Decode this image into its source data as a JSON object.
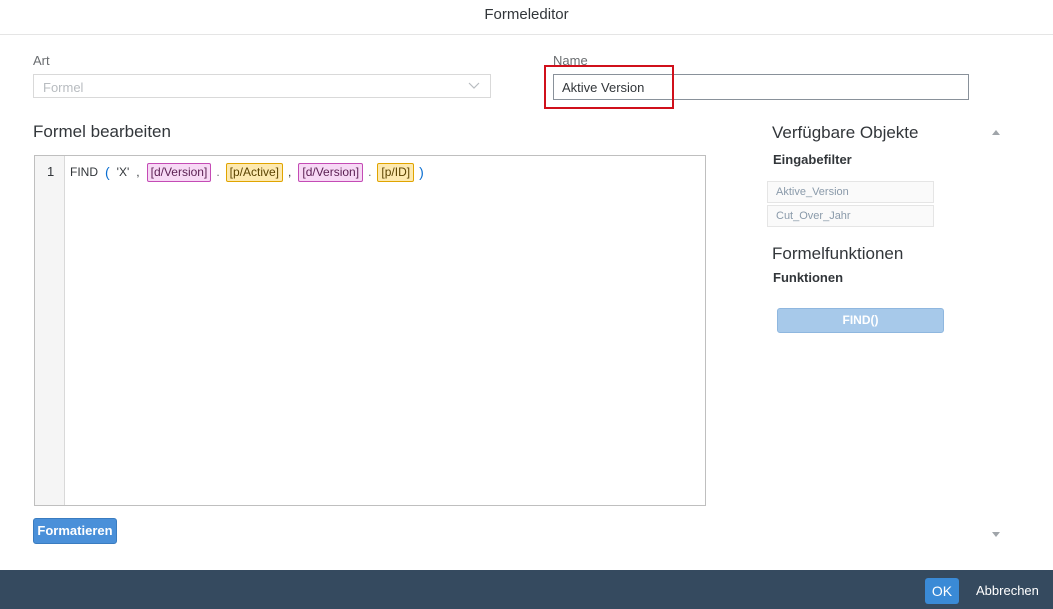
{
  "dialog": {
    "title": "Formeleditor"
  },
  "form": {
    "art_label": "Art",
    "art_value": "Formel",
    "name_label": "Name",
    "name_value": "Aktive Version"
  },
  "editor": {
    "title": "Formel bearbeiten",
    "line_number": "1",
    "tokens": {
      "func": "FIND",
      "open_paren": "(",
      "str": "'X'",
      "comma1": ",",
      "dim1": "[d/Version]",
      "dot1": ".",
      "prop1": "[p/Active]",
      "comma2": ",",
      "dim2": "[d/Version]",
      "dot2": ".",
      "prop2": "[p/ID]",
      "close_paren": ")"
    },
    "format_button": "Formatieren"
  },
  "side": {
    "objects_title": "Verfügbare Objekte",
    "input_filter_title": "Eingabefilter",
    "filters": [
      "Aktive_Version",
      "Cut_Over_Jahr"
    ],
    "functions_title": "Formelfunktionen",
    "functions_sub": "Funktionen",
    "function_buttons": [
      "FIND()"
    ]
  },
  "footer": {
    "ok_label": "OK",
    "cancel_label": "Abbrechen"
  },
  "colors": {
    "footer_bg": "#354a5f",
    "accent": "#3a8ad6",
    "highlight": "#d0101b",
    "dimension_chip": "#f7d9f5",
    "property_chip": "#fde9b0"
  },
  "icons": [
    "chevron-down-icon",
    "scroll-up-icon",
    "scroll-down-icon"
  ]
}
